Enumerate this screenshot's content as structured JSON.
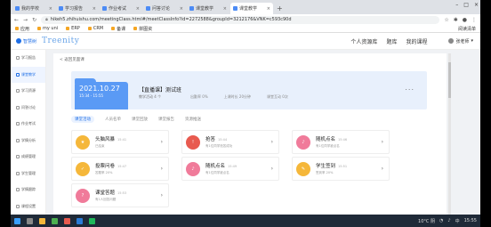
{
  "browser": {
    "tabs": [
      {
        "label": "我的学校",
        "active": false
      },
      {
        "label": "学习报告",
        "active": false
      },
      {
        "label": "作业考试",
        "active": false
      },
      {
        "label": "问答讨论",
        "active": false
      },
      {
        "label": "课堂教学",
        "active": false
      },
      {
        "label": "课堂教学",
        "active": true
      }
    ],
    "url": "hikeh5.zhihuishu.com/meetingClass.html#/meetClassInfo?id=2272588&groupId=3212176&VNK=c593c90d",
    "bookmarks": [
      "应用",
      "my uni",
      "ERP",
      "CRM",
      "备课",
      "拼图资"
    ],
    "bookmarks_right": "阅读清单"
  },
  "site": {
    "logo_text": "智慧树",
    "wordmark": "Treenity",
    "nav": [
      "个人资源库",
      "题库",
      "我的课程"
    ],
    "user_name": "张老师"
  },
  "sidebar": {
    "items": [
      {
        "label": "学习报告",
        "active": false
      },
      {
        "label": "课堂教学",
        "active": true
      },
      {
        "label": "学习资源",
        "active": false
      },
      {
        "label": "问答讨论",
        "active": false
      },
      {
        "label": "作业考试",
        "active": false
      },
      {
        "label": "学情分析",
        "active": false
      },
      {
        "label": "成绩管理",
        "active": false
      },
      {
        "label": "学生管理",
        "active": false
      },
      {
        "label": "学情跟踪",
        "active": false
      },
      {
        "label": "课程设置",
        "active": false
      }
    ]
  },
  "main": {
    "back_label": "< 返回见面课",
    "banner": {
      "date": "2021.10.27",
      "time": "15:34 - 15:55",
      "title": "【直播课】测试班",
      "subtitle": "教学活动 4 个",
      "stats": [
        "出勤率 0%",
        "上课时长 20分钟",
        "课堂互动 0次"
      ],
      "more": "..."
    },
    "tabs": [
      {
        "label": "课堂活动",
        "active": true
      },
      {
        "label": "人员名单",
        "active": false
      },
      {
        "label": "课堂回放",
        "active": false
      },
      {
        "label": "课堂报告",
        "active": false
      },
      {
        "label": "资源推送",
        "active": false
      }
    ],
    "cards": [
      {
        "name": "头脑风暴",
        "time": "15:41",
        "desc": "已结束",
        "color": "#f5b73a",
        "icon": "bulb-icon",
        "glyph": "★"
      },
      {
        "name": "抢答",
        "time": "15:44",
        "desc": "有1位同学抢答成功",
        "color": "#e85a4f",
        "icon": "rush-answer-icon",
        "glyph": "!"
      },
      {
        "name": "随机点名",
        "time": "15:46",
        "desc": "有1位同学被点名",
        "color": "#f07b9a",
        "icon": "random-call-icon",
        "glyph": "♪"
      },
      {
        "name": "投票问卷",
        "time": "15:47",
        "desc": "答题率 20%",
        "color": "#f5b73a",
        "icon": "vote-icon",
        "glyph": "✓"
      },
      {
        "name": "随机点名",
        "time": "15:49",
        "desc": "有1位同学被点名",
        "color": "#f07b9a",
        "icon": "random-call-icon",
        "glyph": "♪"
      },
      {
        "name": "学生签到",
        "time": "15:51",
        "desc": "签到率 20%",
        "color": "#f5b73a",
        "icon": "sign-in-icon",
        "glyph": "✎"
      },
      {
        "name": "课堂答题",
        "time": "15:53",
        "desc": "有1人回答问题",
        "color": "#f07b9a",
        "icon": "quiz-icon",
        "glyph": "?"
      }
    ]
  },
  "taskbar": {
    "weather": "10°C 阴",
    "time": "15:55",
    "ime": "中"
  }
}
